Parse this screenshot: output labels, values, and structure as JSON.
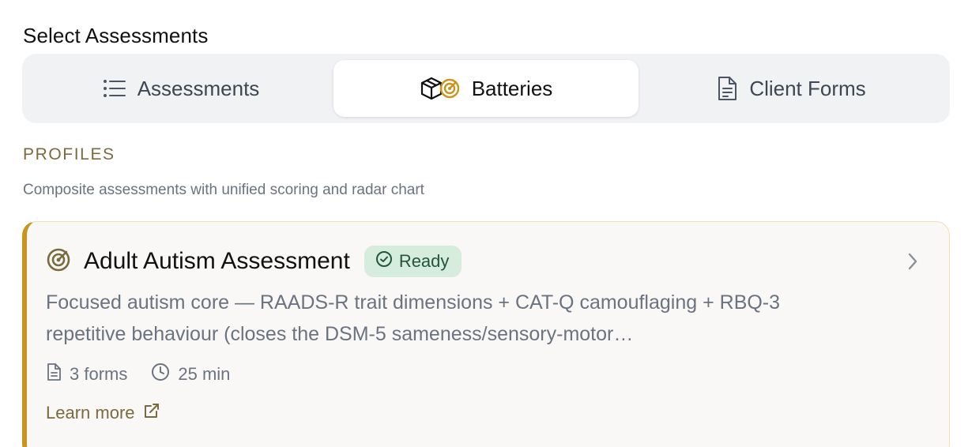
{
  "header": {
    "title": "Select Assessments"
  },
  "tabs": [
    {
      "label": "Assessments",
      "icon": "list-icon",
      "active": false
    },
    {
      "label": "Batteries",
      "icon": "box-radar-icon",
      "active": true
    },
    {
      "label": "Client Forms",
      "icon": "document-icon",
      "active": false
    }
  ],
  "section": {
    "label": "PROFILES",
    "description": "Composite assessments with unified scoring and radar chart"
  },
  "card": {
    "icon": "radar-icon",
    "title": "Adult Autism Assessment",
    "status": "Ready",
    "description": "Focused autism core — RAADS-R trait dimensions + CAT-Q camouflaging + RBQ-3 repetitive behaviour (closes the DSM-5 sameness/sensory-motor…",
    "forms": "3 forms",
    "duration": "25 min",
    "learn_more": "Learn more"
  },
  "colors": {
    "accent": "#c9951c",
    "accent_text": "#7a6a3d",
    "badge_bg": "#d6ecdd",
    "badge_text": "#24553a",
    "tab_bg": "#f1f2f4"
  }
}
